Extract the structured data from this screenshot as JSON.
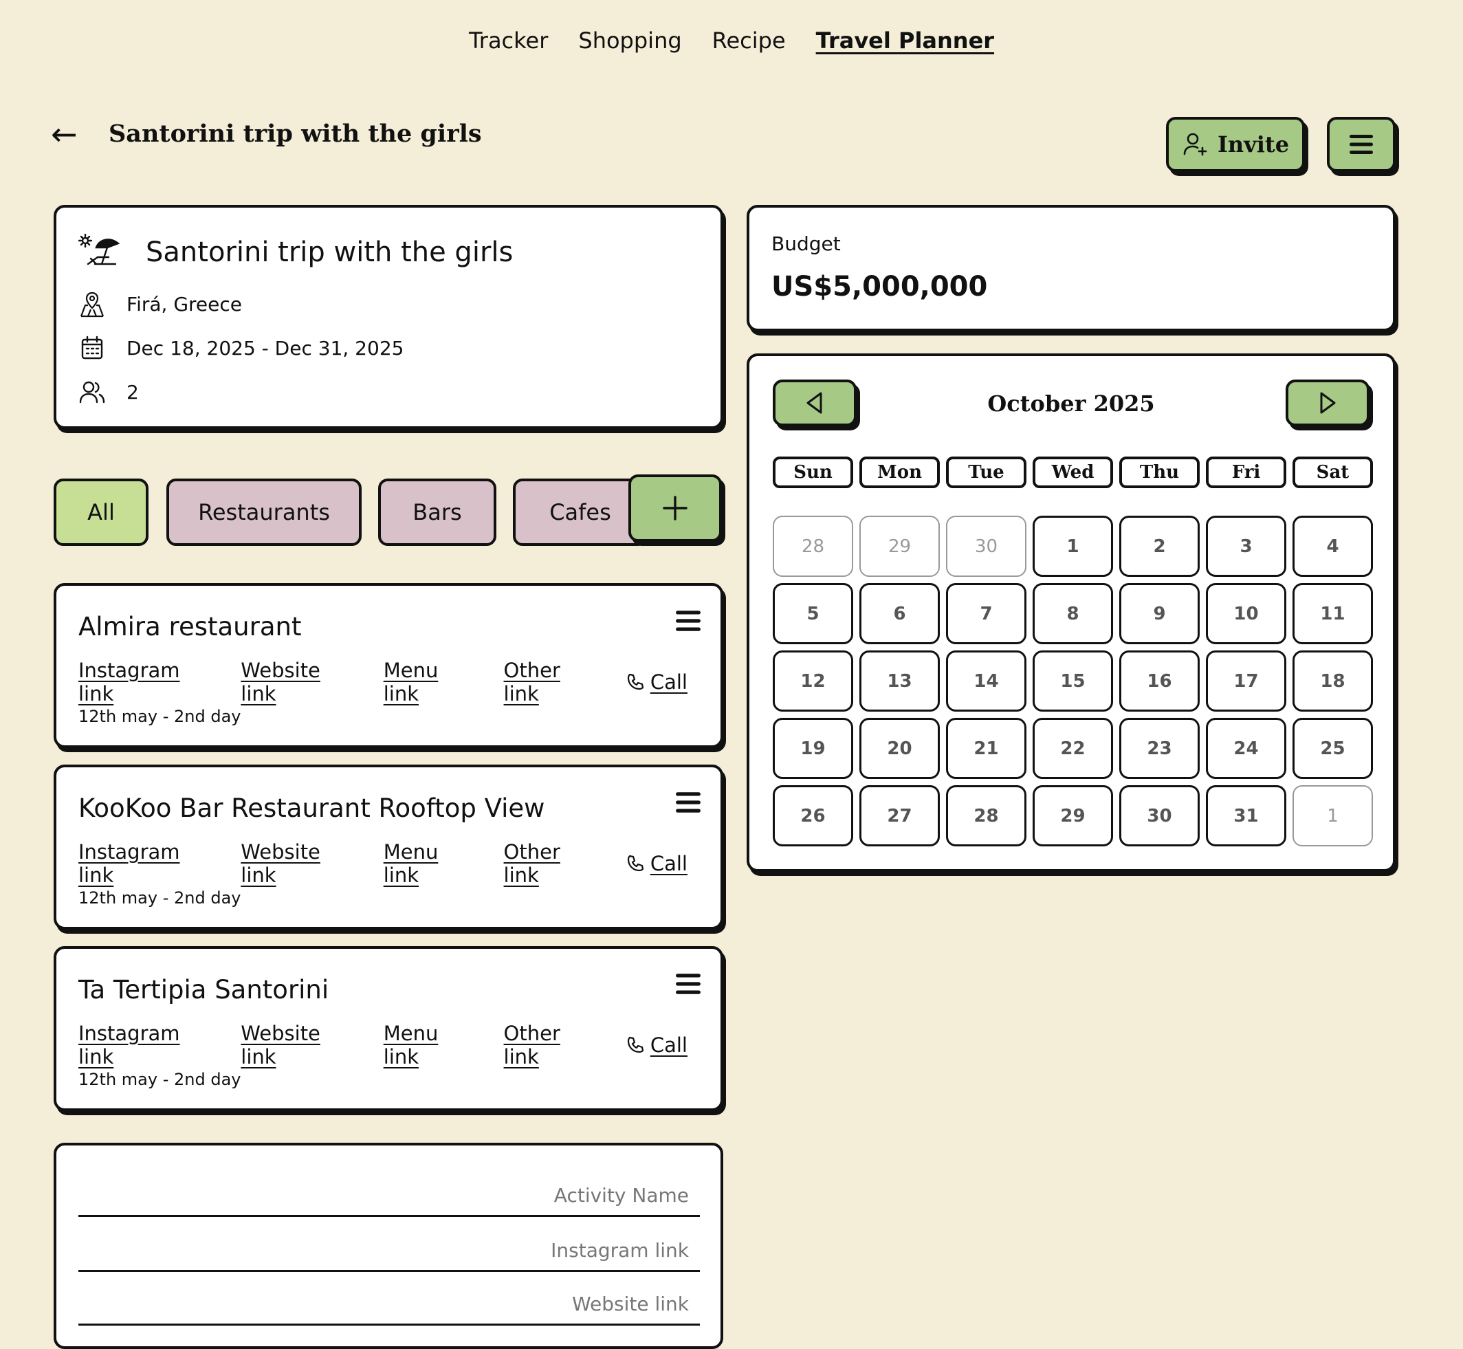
{
  "nav": {
    "items": [
      {
        "label": "Tracker"
      },
      {
        "label": "Shopping"
      },
      {
        "label": "Recipe"
      },
      {
        "label": "Travel Planner"
      }
    ]
  },
  "header": {
    "back_icon": "arrow-left-icon",
    "title": "Santorini trip with the girls",
    "invite_label": "Invite",
    "invite_icon": "user-plus-icon",
    "menu_icon": "hamburger-icon"
  },
  "trip": {
    "icon": "beach-umbrella-icon",
    "title": "Santorini trip with the girls",
    "location": "Firá, Greece",
    "location_icon": "map-pin-icon",
    "dates": "Dec 18, 2025 - Dec 31, 2025",
    "dates_icon": "calendar-icon",
    "travelers": "2",
    "travelers_icon": "users-icon"
  },
  "budget": {
    "label": "Budget",
    "value": "US$5,000,000"
  },
  "calendar": {
    "title": "October 2025",
    "prev_icon": "triangle-left-icon",
    "next_icon": "triangle-right-icon",
    "weekdays": [
      "Sun",
      "Mon",
      "Tue",
      "Wed",
      "Thu",
      "Fri",
      "Sat"
    ],
    "days": [
      {
        "n": "28",
        "muted": true
      },
      {
        "n": "29",
        "muted": true
      },
      {
        "n": "30",
        "muted": true
      },
      {
        "n": "1"
      },
      {
        "n": "2"
      },
      {
        "n": "3"
      },
      {
        "n": "4"
      },
      {
        "n": "5"
      },
      {
        "n": "6"
      },
      {
        "n": "7"
      },
      {
        "n": "8"
      },
      {
        "n": "9"
      },
      {
        "n": "10"
      },
      {
        "n": "11"
      },
      {
        "n": "12"
      },
      {
        "n": "13"
      },
      {
        "n": "14"
      },
      {
        "n": "15"
      },
      {
        "n": "16"
      },
      {
        "n": "17"
      },
      {
        "n": "18"
      },
      {
        "n": "19"
      },
      {
        "n": "20"
      },
      {
        "n": "21"
      },
      {
        "n": "22"
      },
      {
        "n": "23"
      },
      {
        "n": "24"
      },
      {
        "n": "25"
      },
      {
        "n": "26"
      },
      {
        "n": "27"
      },
      {
        "n": "28"
      },
      {
        "n": "29"
      },
      {
        "n": "30"
      },
      {
        "n": "31"
      },
      {
        "n": "1",
        "muted": true
      }
    ]
  },
  "filters": {
    "all": "All",
    "restaurants": "Restaurants",
    "bars": "Bars",
    "cafes": "Cafes",
    "add_icon": "plus-icon"
  },
  "places": [
    {
      "name": "Almira restaurant",
      "instagram": "Instagram link",
      "website": "Website link",
      "menu": "Menu link",
      "other": "Other link",
      "call": "Call",
      "date": "12th may - 2nd day"
    },
    {
      "name": "KooKoo Bar Restaurant Rooftop View",
      "instagram": "Instagram link",
      "website": "Website link",
      "menu": "Menu link",
      "other": "Other link",
      "call": "Call",
      "date": "12th may - 2nd day"
    },
    {
      "name": "Ta Tertipia Santorini",
      "instagram": "Instagram link",
      "website": "Website link",
      "menu": "Menu link",
      "other": "Other link",
      "call": "Call",
      "date": "12th may - 2nd day"
    }
  ],
  "form": {
    "activity_placeholder": "Activity Name",
    "instagram_placeholder": "Instagram link",
    "website_placeholder": "Website link"
  },
  "colors": {
    "background": "#f4edd7",
    "green_button": "#a7c986",
    "chip_active": "#c6df95",
    "chip_inactive": "#d9c1c9"
  }
}
